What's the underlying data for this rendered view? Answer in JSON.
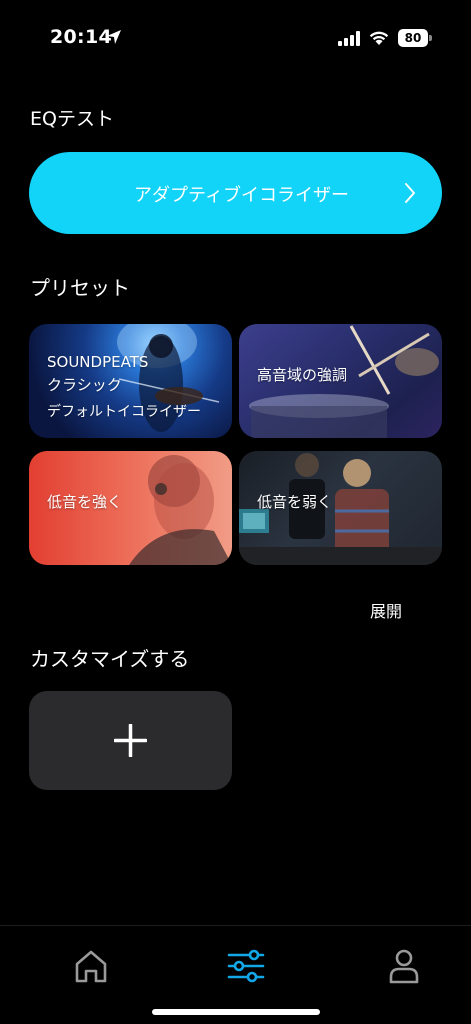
{
  "status_bar": {
    "time": "20:14",
    "battery": "80"
  },
  "eq_test": {
    "title": "EQテスト",
    "adaptive_button_label": "アダプティブイコライザー"
  },
  "presets": {
    "title": "プリセット",
    "cards": [
      {
        "lines": [
          "SOUNDPEATS",
          "クラシック",
          "デフォルトイコライザー"
        ]
      },
      {
        "lines": [
          "高音域の強調"
        ]
      },
      {
        "lines": [
          "低音を強く"
        ]
      },
      {
        "lines": [
          "低音を弱く"
        ]
      }
    ],
    "expand_label": "展開"
  },
  "custom": {
    "title": "カスタマイズする"
  },
  "tab_bar": {
    "tabs": [
      {
        "icon": "home-icon",
        "active": false
      },
      {
        "icon": "equalizer-icon",
        "active": true
      },
      {
        "icon": "profile-icon",
        "active": false
      }
    ],
    "active_color": "#12a8e8",
    "inactive_color": "#9a9a9a"
  },
  "colors": {
    "accent": "#12d3f8",
    "background": "#000000",
    "card_dark": "#2b2b2d"
  }
}
